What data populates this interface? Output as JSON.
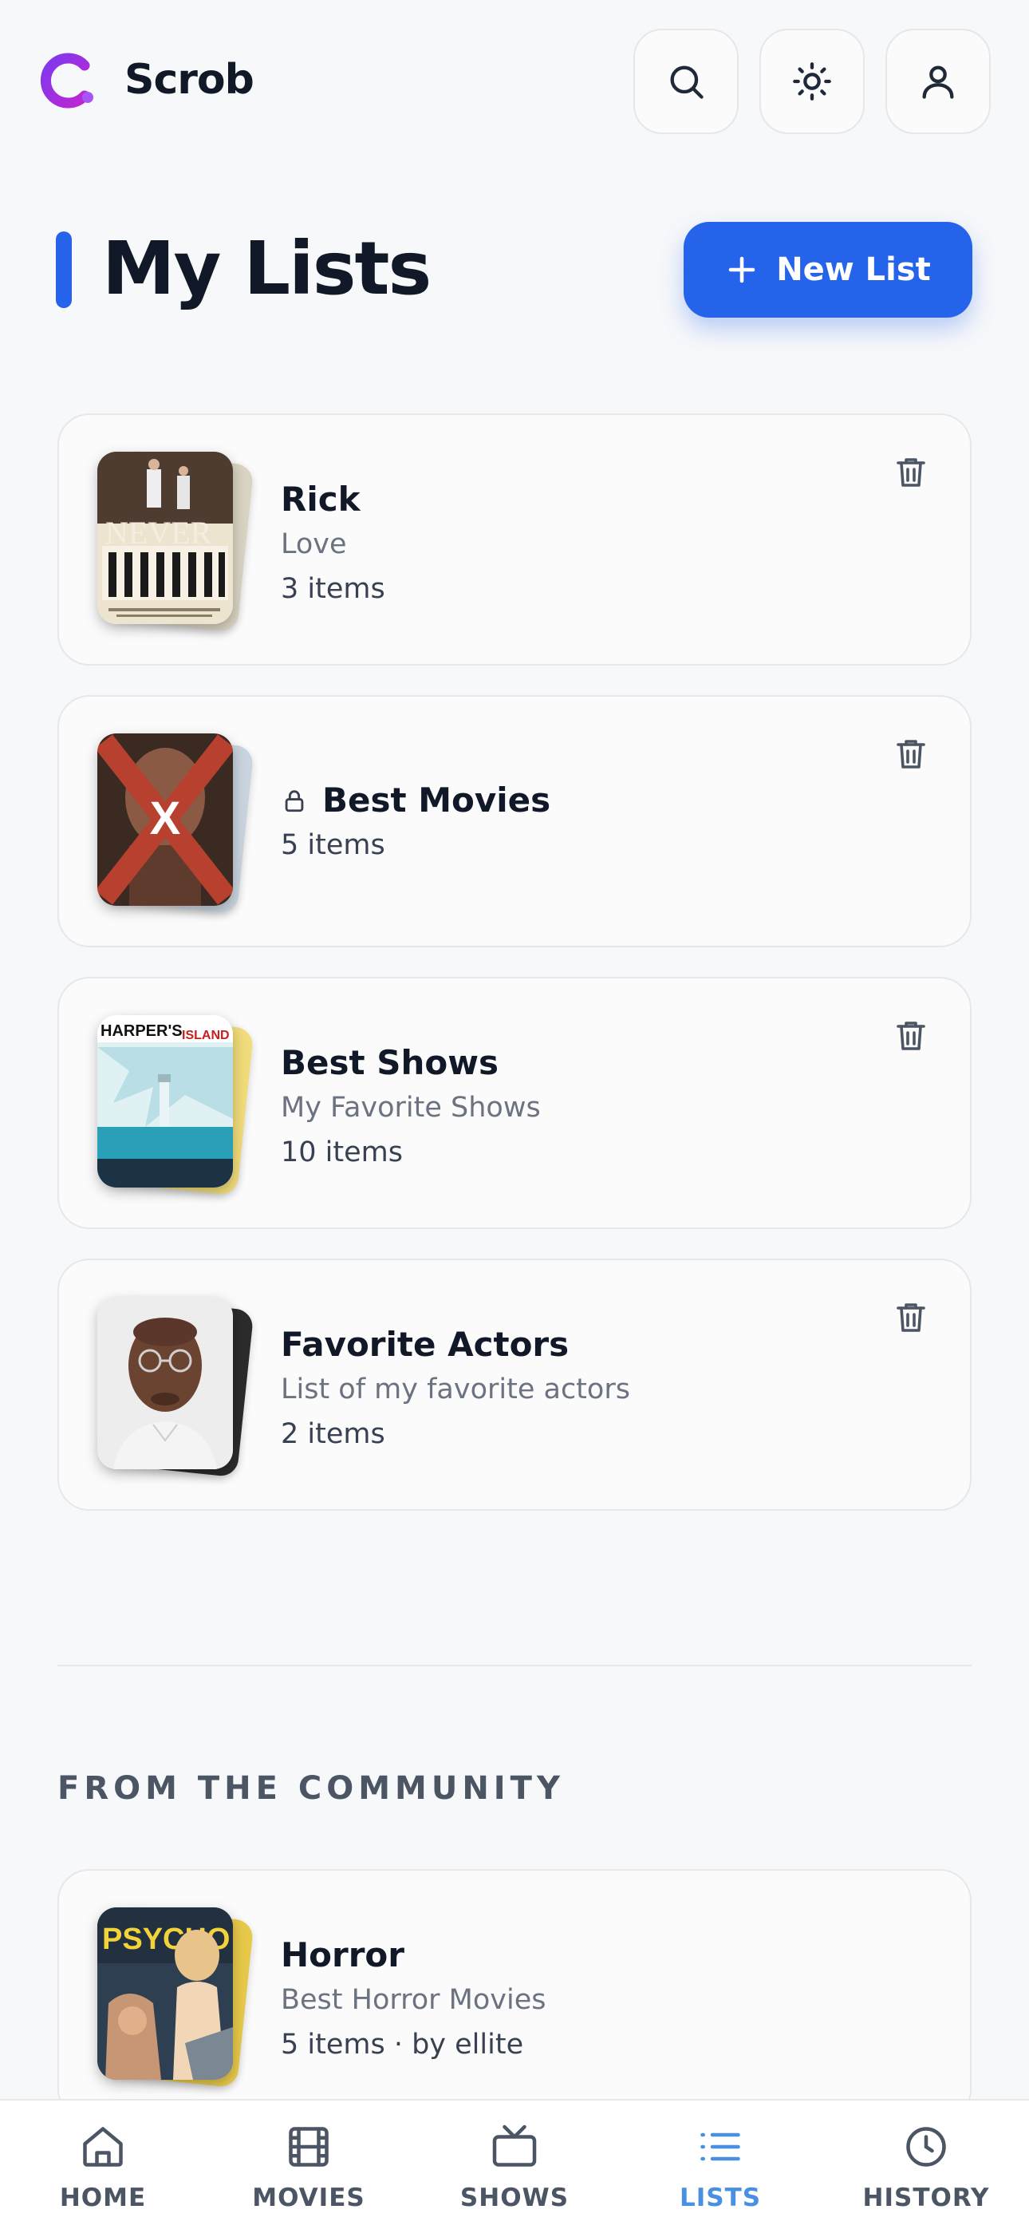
{
  "app": {
    "name": "Scrob"
  },
  "header": {
    "search_icon": "search-icon",
    "theme_icon": "sun-icon",
    "profile_icon": "user-icon"
  },
  "page": {
    "title": "My Lists",
    "new_list_label": "New List"
  },
  "my_lists": [
    {
      "name": "Rick",
      "description": "Love",
      "count": "3 items",
      "private": false
    },
    {
      "name": "Best Movies",
      "description": "",
      "count": "5 items",
      "private": true
    },
    {
      "name": "Best Shows",
      "description": "My Favorite Shows",
      "count": "10 items",
      "private": false
    },
    {
      "name": "Favorite Actors",
      "description": "List of my favorite actors",
      "count": "2 items",
      "private": false
    }
  ],
  "poster_text": {
    "never": "NEVER",
    "x": "X",
    "harpers": "HARPER'S",
    "island": "ISLAND",
    "psycho": "PSYCHO"
  },
  "community": {
    "title": "FROM THE COMMUNITY",
    "lists": [
      {
        "name": "Horror",
        "description": "Best Horror Movies",
        "count": "5 items · by ellite"
      }
    ]
  },
  "nav": [
    {
      "label": "HOME",
      "icon": "home-icon",
      "active": false
    },
    {
      "label": "MOVIES",
      "icon": "film-icon",
      "active": false
    },
    {
      "label": "SHOWS",
      "icon": "tv-icon",
      "active": false
    },
    {
      "label": "LISTS",
      "icon": "list-icon",
      "active": true
    },
    {
      "label": "HISTORY",
      "icon": "clock-icon",
      "active": false
    }
  ],
  "colors": {
    "accent": "#2563eb",
    "nav_active": "#4a90e2",
    "logo": "#a855f7"
  }
}
